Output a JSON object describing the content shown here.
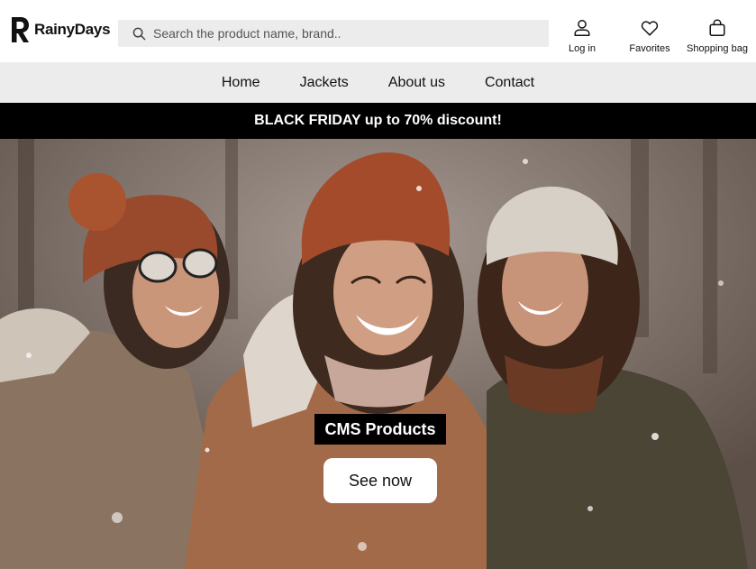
{
  "brand": {
    "logo_letter": "R",
    "name": "RainyDays"
  },
  "search": {
    "placeholder": "Search the product name, brand.."
  },
  "header_actions": {
    "login": "Log in",
    "favorites": "Favorites",
    "bag": "Shopping bag"
  },
  "nav": {
    "items": [
      "Home",
      "Jackets",
      "About us",
      "Contact"
    ]
  },
  "banner": {
    "text": "BLACK FRIDAY up to 70% discount!"
  },
  "hero": {
    "title": "CMS Products",
    "cta": "See now",
    "image_alt": "Three women in winter hats laughing in the snow"
  },
  "colors": {
    "nav_bg": "#ececec",
    "banner_bg": "#000000",
    "search_bg": "#ececec"
  }
}
